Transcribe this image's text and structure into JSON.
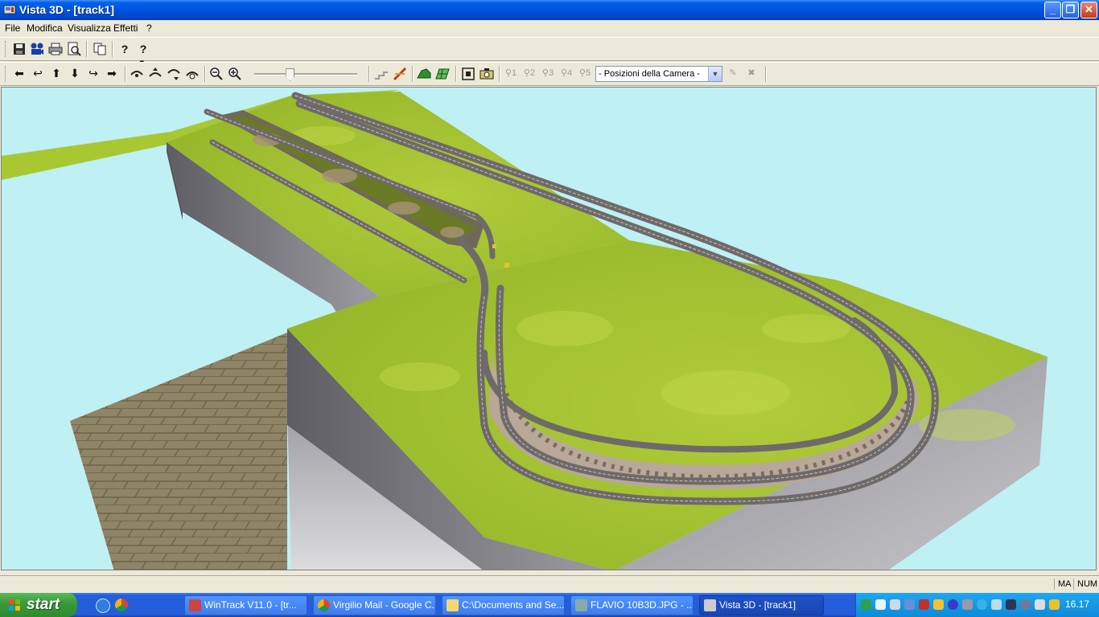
{
  "window": {
    "title": "Vista 3D - [track1]",
    "minimize": "_",
    "restore": "❐",
    "close": "✕"
  },
  "menu": [
    "File",
    "Modifica",
    "Visualizza",
    "Effetti",
    "?"
  ],
  "toolbar1": {
    "icons": [
      "save-icon",
      "camera-reel-icon",
      "print-icon",
      "print-preview-icon",
      "copy-icon",
      "help-icon",
      "context-help-icon"
    ]
  },
  "toolbar2": {
    "nav_glyphs": [
      "⬅",
      "↩",
      "⬆",
      "⬇",
      "↪",
      "➡"
    ],
    "camera_positions": [
      "1",
      "2",
      "3",
      "4",
      "5"
    ],
    "camera_select": "- Posizioni della Camera -",
    "slider_value": 0.35
  },
  "status": {
    "cells": [
      "MA",
      "NUM"
    ]
  },
  "taskbar": {
    "start": "start",
    "tasks": [
      "WinTrack  V11.0 - [tr...",
      "Virgilio Mail - Google C...",
      "C:\\Documents and Se...",
      "FLAVIO 10B3D.JPG - ...",
      "Vista 3D - [track1]"
    ],
    "clock": "16.17"
  },
  "colors": {
    "sky": "#bff0f4",
    "grass": "#a8c832",
    "cliff": "#7a7a80",
    "track": "#6f6a6a",
    "floor": "#8f8466"
  }
}
